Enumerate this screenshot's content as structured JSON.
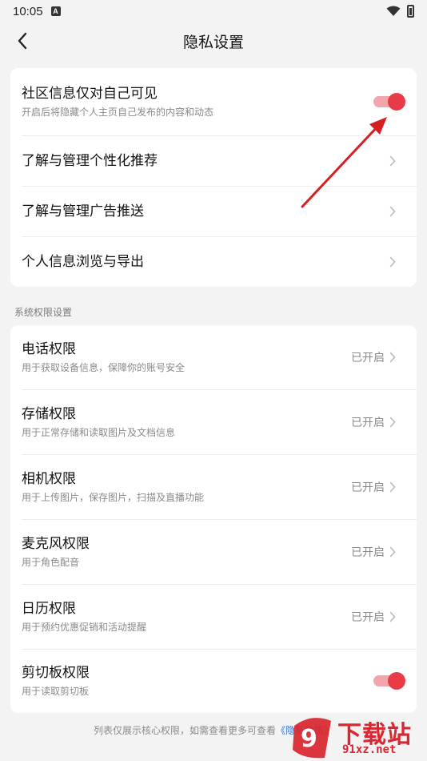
{
  "status_bar": {
    "time": "10:05",
    "notification_glyph": "A",
    "icons": [
      "wifi-icon",
      "battery-icon"
    ]
  },
  "header": {
    "title": "隐私设置",
    "back_icon": "chevron-left-icon"
  },
  "privacy_card": {
    "items": [
      {
        "label": "社区信息仅对自己可见",
        "desc": "开启后将隐藏个人主页自己发布的内容和动态",
        "control": "toggle",
        "on": true
      },
      {
        "label": "了解与管理个性化推荐",
        "control": "chevron"
      },
      {
        "label": "了解与管理广告推送",
        "control": "chevron"
      },
      {
        "label": "个人信息浏览与导出",
        "control": "chevron"
      }
    ]
  },
  "section_label": "系统权限设置",
  "permissions_card": {
    "items": [
      {
        "label": "电话权限",
        "desc": "用于获取设备信息，保障你的账号安全",
        "status": "已开启"
      },
      {
        "label": "存储权限",
        "desc": "用于正常存储和读取图片及文档信息",
        "status": "已开启"
      },
      {
        "label": "相机权限",
        "desc": "用于上传图片，保存图片，扫描及直播功能",
        "status": "已开启"
      },
      {
        "label": "麦克风权限",
        "desc": "用于角色配音",
        "status": "已开启"
      },
      {
        "label": "日历权限",
        "desc": "用于预约优惠促销和活动提醒",
        "status": "已开启"
      },
      {
        "label": "剪切板权限",
        "desc": "用于读取剪切板",
        "control": "toggle",
        "on": true
      }
    ]
  },
  "footer": {
    "text": "列表仅展示核心权限，如需查看更多可查看",
    "link": "《隐私政策》"
  },
  "watermark": {
    "brand": "下载站",
    "url": "91xz.net"
  },
  "colors": {
    "accent": "#e93a47",
    "toggle_track": "#f3a5ac",
    "link": "#2f6fd6",
    "background": "#f3f3f3"
  }
}
